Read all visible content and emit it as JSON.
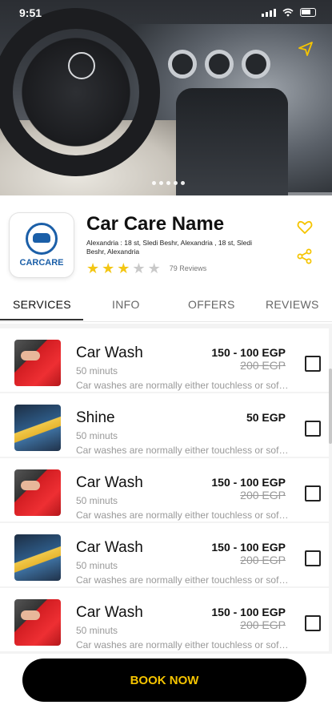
{
  "status_bar": {
    "time": "9:51"
  },
  "hero": {
    "image_dots": 5
  },
  "shop": {
    "name": "Car Care Name",
    "logo_text": "CARCARE",
    "address": "Alexandria : 18 st, Sledi Beshr, Alexandria , 18 st, Sledi Beshr, Alexandria",
    "rating": 3,
    "rating_max": 5,
    "reviews": "79 Reviews"
  },
  "tabs": [
    {
      "label": "SERVICES",
      "active": true
    },
    {
      "label": "INFO",
      "active": false
    },
    {
      "label": "OFFERS",
      "active": false
    },
    {
      "label": "REVIEWS",
      "active": false
    }
  ],
  "services": [
    {
      "name": "Car Wash",
      "duration": "50 minuts",
      "price": "150 - 100 EGP",
      "old_price": "200 EGP",
      "description": "Car washes are normally either touchless or soft-cloth.",
      "thumb": "red"
    },
    {
      "name": "Shine",
      "duration": "50 minuts",
      "price": "50 EGP",
      "old_price": "",
      "description": "Car washes are normally either touchless or soft-cloth.",
      "thumb": "blue"
    },
    {
      "name": "Car Wash",
      "duration": "50 minuts",
      "price": "150 - 100 EGP",
      "old_price": "200 EGP",
      "description": "Car washes are normally either touchless or soft-cloth.",
      "thumb": "red"
    },
    {
      "name": "Car Wash",
      "duration": "50 minuts",
      "price": "150 - 100 EGP",
      "old_price": "200 EGP",
      "description": "Car washes are normally either touchless or soft-cloth.",
      "thumb": "blue"
    },
    {
      "name": "Car Wash",
      "duration": "50 minuts",
      "price": "150 - 100 EGP",
      "old_price": "200 EGP",
      "description": "Car washes are normally either touchless or soft-cloth.",
      "thumb": "red"
    }
  ],
  "book_button": "BOOK NOW",
  "colors": {
    "accent": "#F5C400",
    "star": "#F3C614",
    "logo_blue": "#1B5FA8"
  }
}
